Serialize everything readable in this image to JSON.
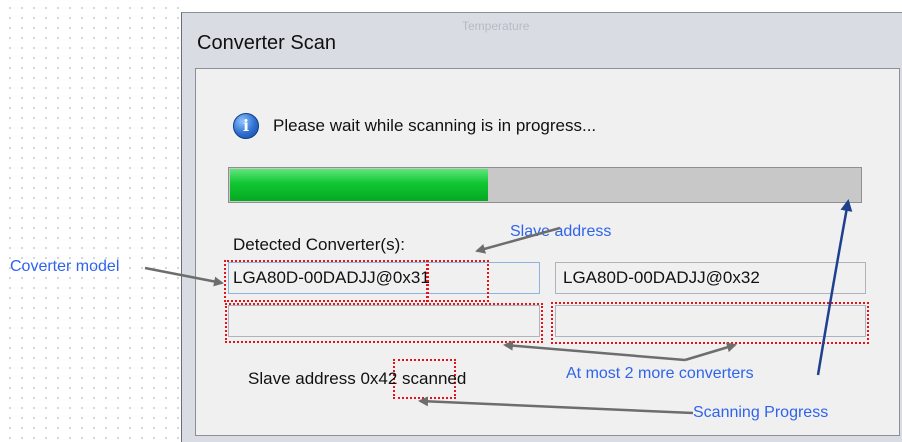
{
  "window": {
    "title": "Converter Scan"
  },
  "background_window": {
    "partial_text": "Temperature"
  },
  "message": {
    "icon": "info-icon",
    "text": "Please wait while scanning is in progress..."
  },
  "progress": {
    "fraction": 0.41,
    "fill_color": "#10c732"
  },
  "detected": {
    "label": "Detected Converter(s):",
    "fields": [
      {
        "value": "LGA80D-00DADJJ@0x31"
      },
      {
        "value": "LGA80D-00DADJJ@0x32"
      },
      {
        "value": ""
      },
      {
        "value": ""
      }
    ]
  },
  "status": {
    "prefix": "Slave address ",
    "address": "0x42",
    "suffix": " scanned"
  },
  "annotations": {
    "coverter_model": "Coverter model",
    "slave_address": "Slave address",
    "more_converters": "At most 2 more converters",
    "scanning_progress": "Scanning Progress"
  },
  "colors": {
    "annotation_text": "#2f64ea",
    "highlight_border": "#e0141a",
    "arrow": "#6d6d6d",
    "progress_arrow": "#1f3f8f"
  }
}
